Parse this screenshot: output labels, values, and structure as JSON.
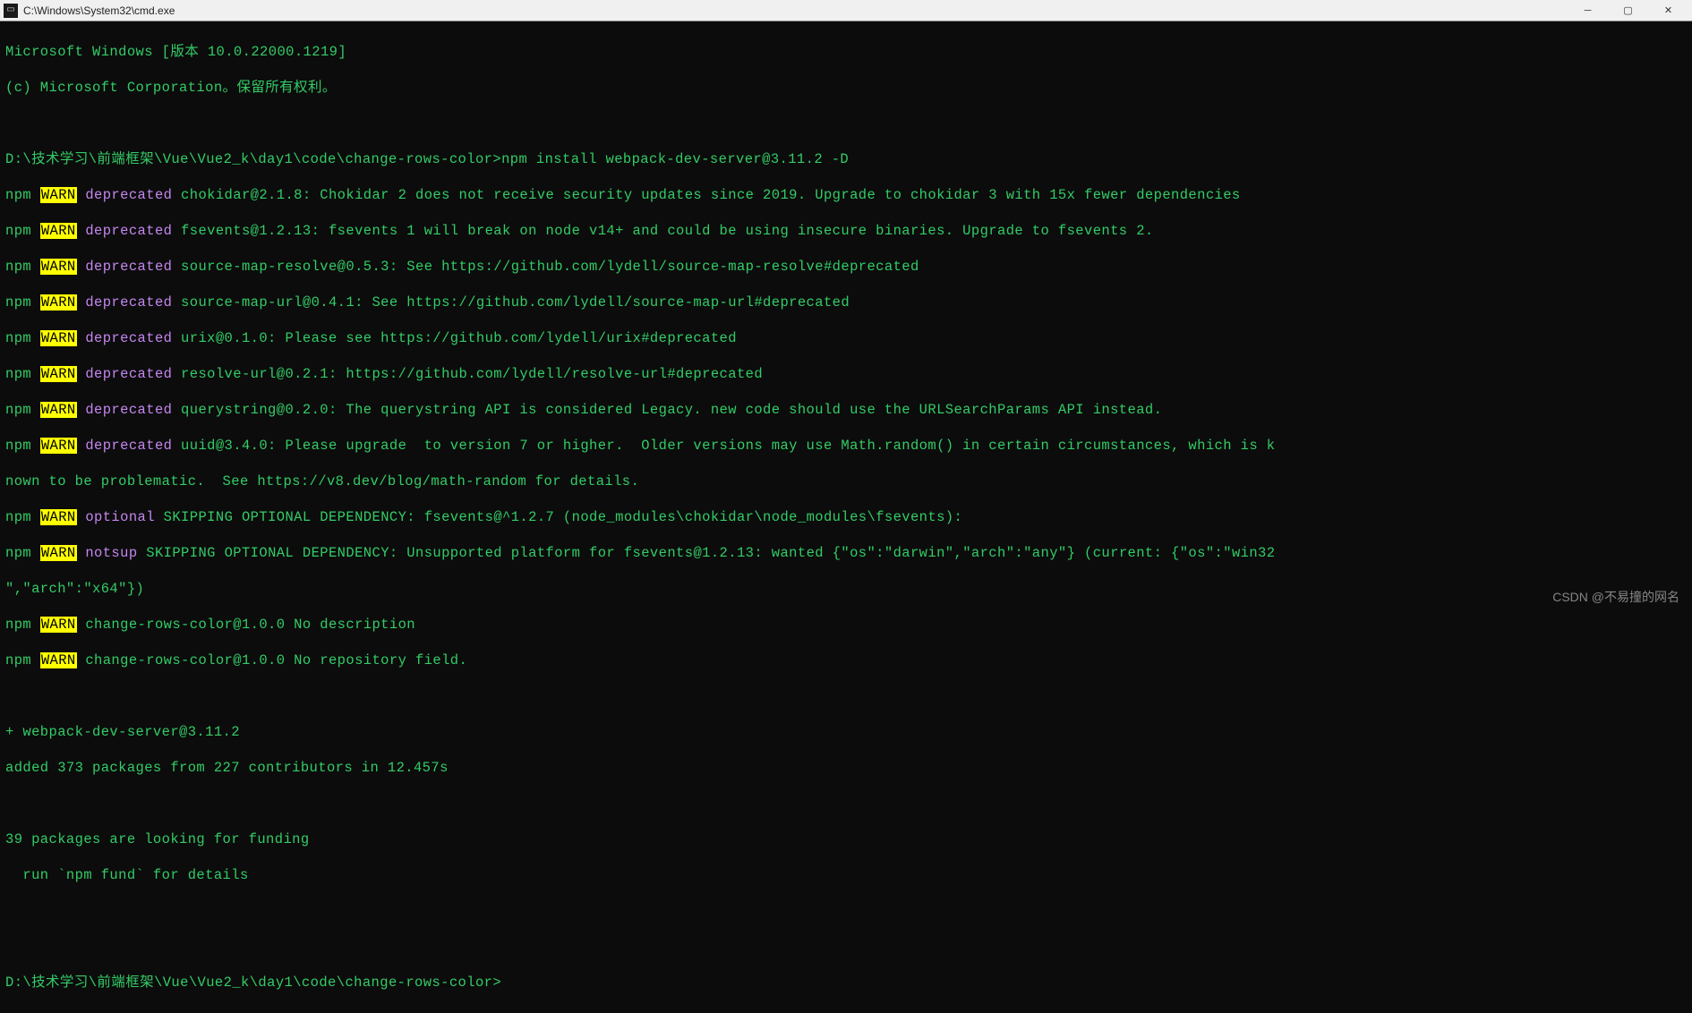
{
  "window": {
    "title": "C:\\Windows\\System32\\cmd.exe"
  },
  "header": {
    "line1": "Microsoft Windows [版本 10.0.22000.1219]",
    "line2": "(c) Microsoft Corporation。保留所有权利。"
  },
  "prompt1": {
    "path": "D:\\技术学习\\前端框架\\Vue\\Vue2_k\\day1\\code\\change-rows-color>",
    "cmd": "npm install webpack-dev-server@3.11.2 -D"
  },
  "warns": [
    {
      "kind": "deprecated",
      "msg": "chokidar@2.1.8: Chokidar 2 does not receive security updates since 2019. Upgrade to chokidar 3 with 15x fewer dependencies"
    },
    {
      "kind": "deprecated",
      "msg": "fsevents@1.2.13: fsevents 1 will break on node v14+ and could be using insecure binaries. Upgrade to fsevents 2."
    },
    {
      "kind": "deprecated",
      "msg": "source-map-resolve@0.5.3: See https://github.com/lydell/source-map-resolve#deprecated"
    },
    {
      "kind": "deprecated",
      "msg": "source-map-url@0.4.1: See https://github.com/lydell/source-map-url#deprecated"
    },
    {
      "kind": "deprecated",
      "msg": "urix@0.1.0: Please see https://github.com/lydell/urix#deprecated"
    },
    {
      "kind": "deprecated",
      "msg": "resolve-url@0.2.1: https://github.com/lydell/resolve-url#deprecated"
    },
    {
      "kind": "deprecated",
      "msg": "querystring@0.2.0: The querystring API is considered Legacy. new code should use the URLSearchParams API instead."
    },
    {
      "kind": "deprecated",
      "msg": "uuid@3.4.0: Please upgrade  to version 7 or higher.  Older versions may use Math.random() in certain circumstances, which is k"
    }
  ],
  "wrap1": "nown to be problematic.  See https://v8.dev/blog/math-random for details.",
  "warns2": [
    {
      "kind": "optional",
      "msg": "SKIPPING OPTIONAL DEPENDENCY: fsevents@^1.2.7 (node_modules\\chokidar\\node_modules\\fsevents):"
    },
    {
      "kind": "notsup",
      "msg": "SKIPPING OPTIONAL DEPENDENCY: Unsupported platform for fsevents@1.2.13: wanted {\"os\":\"darwin\",\"arch\":\"any\"} (current: {\"os\":\"win32"
    }
  ],
  "wrap2": "\",\"arch\":\"x64\"})",
  "warns3": [
    {
      "msg": "change-rows-color@1.0.0 No description"
    },
    {
      "msg": "change-rows-color@1.0.0 No repository field."
    }
  ],
  "result": {
    "added": "+ webpack-dev-server@3.11.2",
    "summary": "added 373 packages from 227 contributors in 12.457s",
    "funding1": "39 packages are looking for funding",
    "funding2": "  run `npm fund` for details"
  },
  "prompt2": {
    "path": "D:\\技术学习\\前端框架\\Vue\\Vue2_k\\day1\\code\\change-rows-color>"
  },
  "labels": {
    "npm": "npm",
    "warn": "WARN",
    "deprecated": "deprecated",
    "optional": "optional",
    "notsup": "notsup"
  },
  "watermark": "CSDN @不易撞的网名"
}
